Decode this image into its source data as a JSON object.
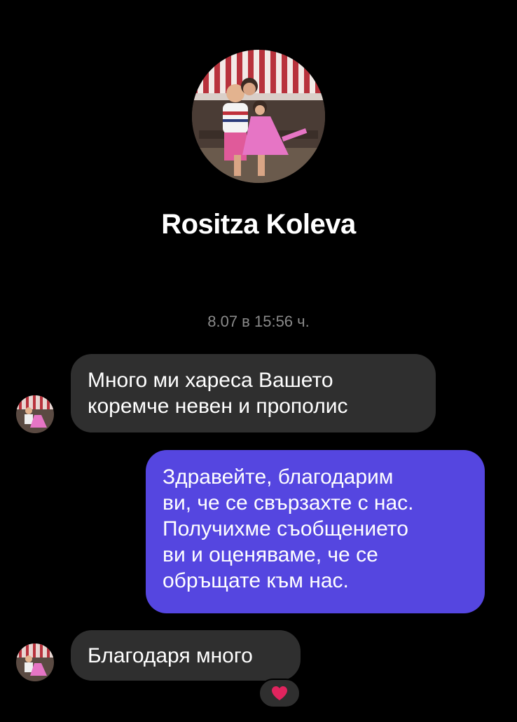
{
  "contact": {
    "name": "Rositza Koleva"
  },
  "conversation": {
    "timestamp": "8.07 в 15:56 ч.",
    "messages": [
      {
        "direction": "incoming",
        "lines": [
          "Много ми хареса Вашето",
          "коремче невен и прополис"
        ]
      },
      {
        "direction": "outgoing",
        "lines": [
          "Здравейте, благодарим",
          "ви, че се свързахте с нас.",
          "Получихме съобщението",
          "ви и оценяваме, че се",
          "обръщате към нас."
        ]
      },
      {
        "direction": "incoming",
        "lines": [
          "Благодаря много"
        ],
        "reaction": "heart-icon"
      }
    ]
  },
  "colors": {
    "background": "#000000",
    "incoming_bubble": "#2f2f2f",
    "outgoing_bubble": "#5546e0",
    "timestamp": "#8a8a8a",
    "reaction_heart": "#e0245e"
  }
}
